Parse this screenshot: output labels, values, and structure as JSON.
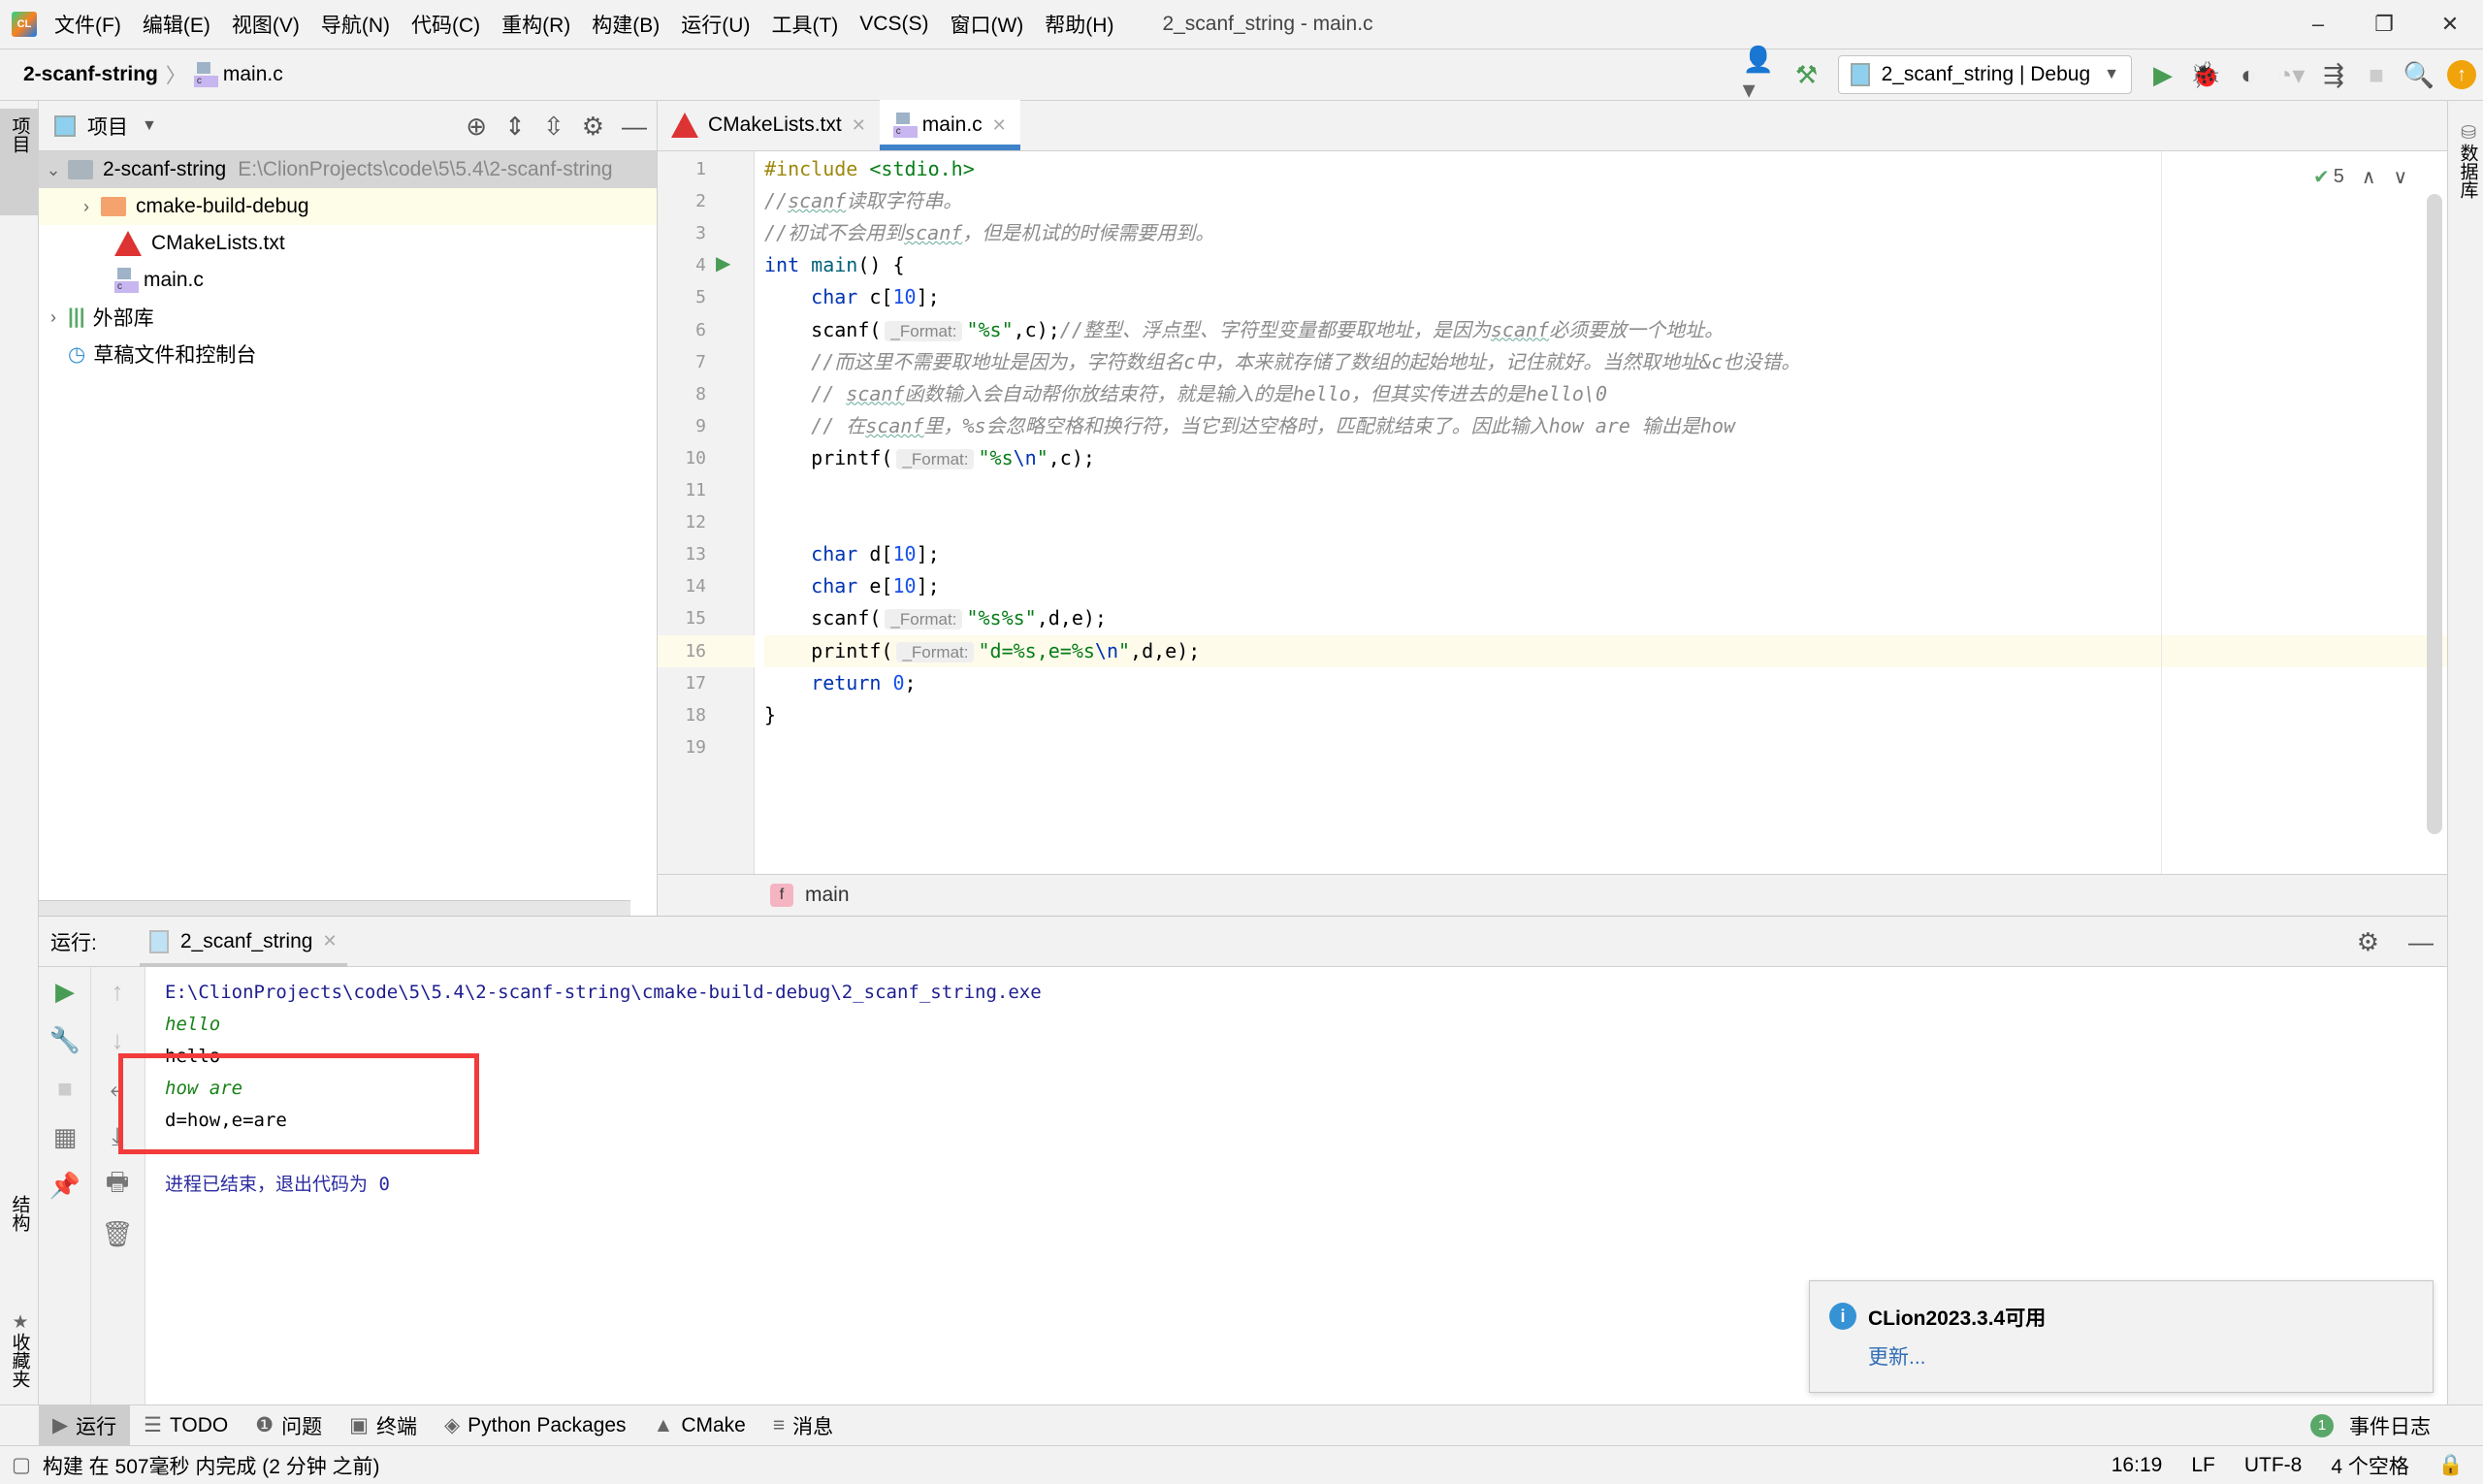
{
  "window": {
    "title": "2_scanf_string - main.c",
    "menu": [
      "文件(F)",
      "编辑(E)",
      "视图(V)",
      "导航(N)",
      "代码(C)",
      "重构(R)",
      "构建(B)",
      "运行(U)",
      "工具(T)",
      "VCS(S)",
      "窗口(W)",
      "帮助(H)"
    ],
    "controls": {
      "minimize": "–",
      "restore": "❐",
      "close": "✕"
    }
  },
  "navbar": {
    "project": "2-scanf-string",
    "file": "main.c",
    "run_config": "2_scanf_string | Debug"
  },
  "toolbar_icons": [
    "user-icon",
    "build-hammer-icon",
    "run-icon",
    "debug-icon",
    "coverage-icon",
    "profile-icon",
    "attach-icon",
    "stop-icon",
    "search-icon",
    "update-icon"
  ],
  "project_panel": {
    "header": "项目",
    "tree": [
      {
        "label": "2-scanf-string",
        "path": "E:\\ClionProjects\\code\\5\\5.4\\2-scanf-string",
        "type": "project-folder",
        "expanded": true
      },
      {
        "label": "cmake-build-debug",
        "type": "folder",
        "expanded": false
      },
      {
        "label": "CMakeLists.txt",
        "type": "cmake-file"
      },
      {
        "label": "main.c",
        "type": "c-file"
      },
      {
        "label": "外部库",
        "type": "library",
        "expanded": false
      },
      {
        "label": "草稿文件和控制台",
        "type": "scratches"
      }
    ]
  },
  "side_tabs": {
    "left_top": "项目",
    "left_structure": "结构",
    "left_favorites": "收藏夹",
    "right_db": "数据库"
  },
  "editor": {
    "tabs": [
      {
        "label": "CMakeLists.txt",
        "active": false
      },
      {
        "label": "main.c",
        "active": true
      }
    ],
    "inspections_count": "5",
    "current_line": 16,
    "hint_label": "_Format:",
    "lines": [
      "#include <stdio.h>",
      "//scanf读取字符串。",
      "//初试不会用到scanf，但是机试的时候需要用到。",
      "int main() {",
      "    char c[10];",
      "    scanf(\"%s\",c);//整型、浮点型、字符型变量都要取地址，是因为scanf必须要放一个地址。",
      "    //而这里不需要取地址是因为，字符数组名c中，本来就存储了数组的起始地址，记住就好。当然取地址&c也没错。",
      "    // scanf函数输入会自动帮你放结束符，就是输入的是hello，但其实传进去的是hello\\0",
      "    // 在scanf里，%s会忽略空格和换行符，当它到达空格时，匹配就结束了。因此输入how are 输出是how",
      "    printf(\"%s\\n\",c);",
      "",
      "",
      "    char d[10];",
      "    char e[10];",
      "    scanf(\"%s%s\",d,e);",
      "    printf(\"d=%s,e=%s\\n\",d,e);",
      "    return 0;",
      "}",
      ""
    ],
    "breadcrumb_function": "main"
  },
  "run_panel": {
    "label": "运行:",
    "tab": "2_scanf_string",
    "output": [
      {
        "text": "E:\\ClionProjects\\code\\5\\5.4\\2-scanf-string\\cmake-build-debug\\2_scanf_string.exe",
        "kind": "path"
      },
      {
        "text": "hello",
        "kind": "input"
      },
      {
        "text": "hello",
        "kind": "output"
      },
      {
        "text": "how are",
        "kind": "input"
      },
      {
        "text": "d=how,e=are",
        "kind": "output"
      },
      {
        "text": "",
        "kind": "output"
      },
      {
        "text": "进程已结束，退出代码为 0",
        "kind": "exit"
      }
    ]
  },
  "notification": {
    "title": "CLion2023.3.4可用",
    "link": "更新..."
  },
  "tool_windows": [
    "运行",
    "TODO",
    "问题",
    "终端",
    "Python Packages",
    "CMake",
    "消息"
  ],
  "event_log": {
    "count": "1",
    "label": "事件日志"
  },
  "status": {
    "message": "构建 在 507毫秒 内完成 (2 分钟 之前)",
    "position": "16:19",
    "line_sep": "LF",
    "encoding": "UTF-8",
    "indent": "4 个空格"
  },
  "colors": {
    "accent": "#4083c9",
    "run_green": "#59a869",
    "highlight_box": "#f23b3b",
    "update_orange": "#f0a30a"
  }
}
